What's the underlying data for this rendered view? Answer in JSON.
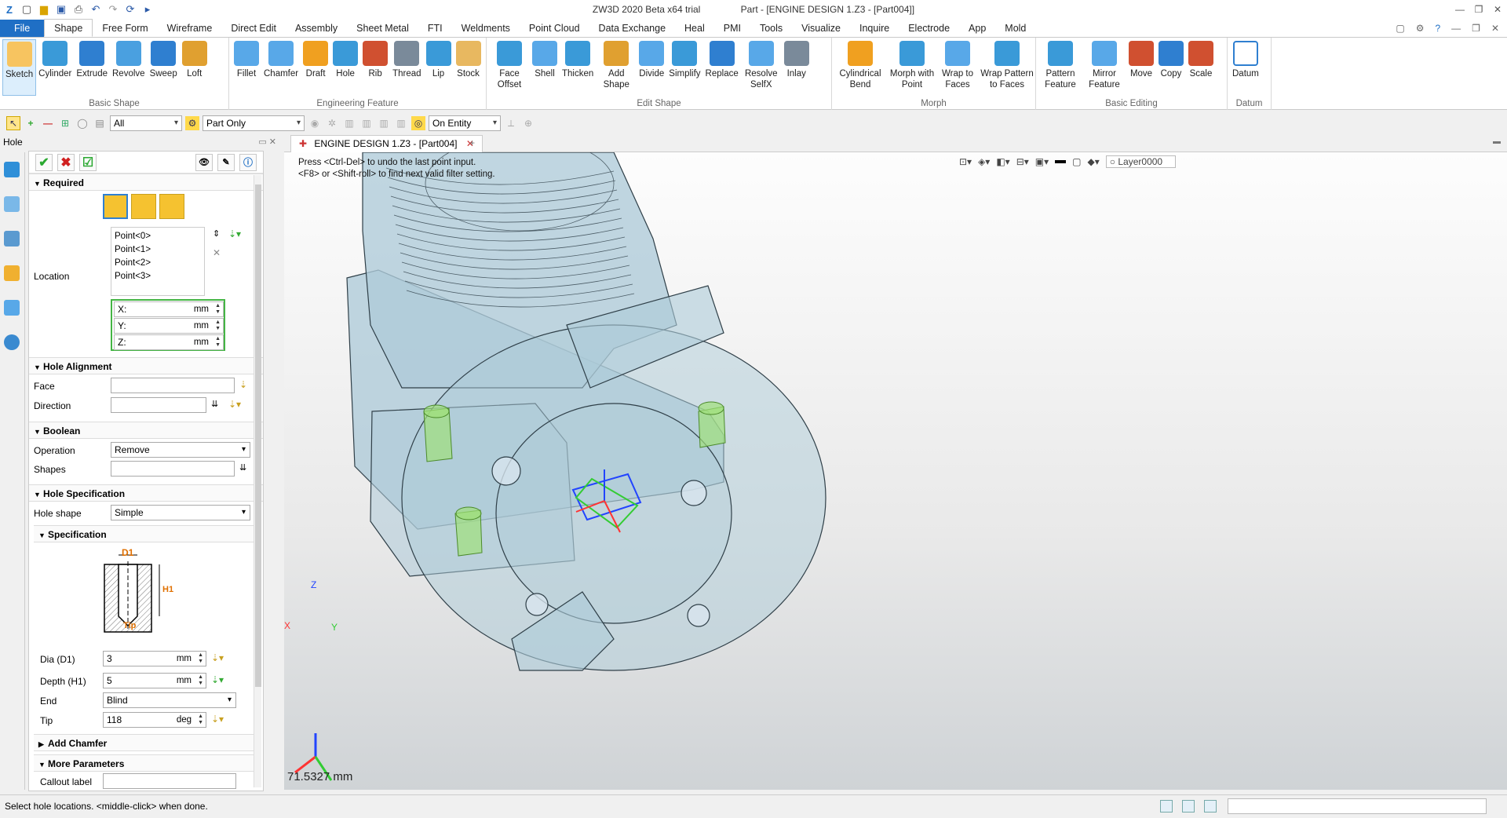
{
  "app": {
    "title_left": "ZW3D 2020 Beta x64 trial",
    "title_right": "Part - [ENGINE DESIGN 1.Z3 - [Part004]]"
  },
  "menu": {
    "file": "File",
    "tabs": [
      "Shape",
      "Free Form",
      "Wireframe",
      "Direct Edit",
      "Assembly",
      "Sheet Metal",
      "FTI",
      "Weldments",
      "Point Cloud",
      "Data Exchange",
      "Heal",
      "PMI",
      "Tools",
      "Visualize",
      "Inquire",
      "Electrode",
      "App",
      "Mold"
    ]
  },
  "ribbon": {
    "groups": [
      {
        "label": "Basic Shape",
        "buttons": [
          "Sketch",
          "Cylinder",
          "Extrude",
          "Revolve",
          "Sweep",
          "Loft"
        ]
      },
      {
        "label": "Engineering Feature",
        "buttons": [
          "Fillet",
          "Chamfer",
          "Draft",
          "Hole",
          "Rib",
          "Thread",
          "Lip",
          "Stock"
        ]
      },
      {
        "label": "Edit Shape",
        "buttons": [
          "Face Offset",
          "Shell",
          "Thicken",
          "Add Shape",
          "Divide",
          "Simplify",
          "Replace",
          "Resolve SelfX",
          "Inlay"
        ]
      },
      {
        "label": "Morph",
        "buttons": [
          "Cylindrical Bend",
          "Morph with Point",
          "Wrap to Faces",
          "Wrap Pattern to Faces"
        ]
      },
      {
        "label": "Basic Editing",
        "buttons": [
          "Pattern Feature",
          "Mirror Feature",
          "Move",
          "Copy",
          "Scale"
        ]
      },
      {
        "label": "Datum",
        "buttons": [
          "Datum"
        ]
      }
    ],
    "colors": [
      "#2f7fd0",
      "#f0a020",
      "#3a9ad8",
      "#e0a030",
      "#4aa0e0",
      "#d05030",
      "#7a8a9a",
      "#58a8e8"
    ]
  },
  "toolbar2": {
    "filter_value": "All",
    "scope_value": "Part Only",
    "snap_value": "On Entity"
  },
  "left_panel": {
    "title": "Hole",
    "required_label": "Required",
    "location_label": "Location",
    "points": [
      "Point<0>",
      "Point<1>",
      "Point<2>",
      "Point<3>"
    ],
    "x_label": "X:",
    "y_label": "Y:",
    "z_label": "Z:",
    "unit_mm": "mm",
    "hole_alignment_label": "Hole Alignment",
    "face_label": "Face",
    "direction_label": "Direction",
    "boolean_label": "Boolean",
    "operation_label": "Operation",
    "operation_value": "Remove",
    "shapes_label": "Shapes",
    "hole_spec_label": "Hole Specification",
    "hole_shape_label": "Hole shape",
    "hole_shape_value": "Simple",
    "specification_label": "Specification",
    "diagram_d1": "D1",
    "diagram_h1": "H1",
    "diagram_tip": "Tip",
    "dia_label": "Dia (D1)",
    "dia_value": "3",
    "depth_label": "Depth (H1)",
    "depth_value": "5",
    "end_label": "End",
    "end_value": "Blind",
    "tip_label": "Tip",
    "tip_value": "118",
    "unit_deg": "deg",
    "add_chamfer_label": "Add Chamfer",
    "more_params_label": "More Parameters",
    "callout_label": "Callout label"
  },
  "viewport": {
    "doc_tab": "ENGINE DESIGN 1.Z3 - [Part004]",
    "hint_line1": "Press <Ctrl-Del> to undo the last point input.",
    "hint_line2": "<F8> or <Shift-roll> to find next valid filter setting.",
    "layer": "Layer0000",
    "measure": "71.5327 mm",
    "axis_x": "X",
    "axis_y": "Y",
    "axis_z": "Z"
  },
  "status": {
    "text": "Select hole locations. <middle-click> when done."
  }
}
